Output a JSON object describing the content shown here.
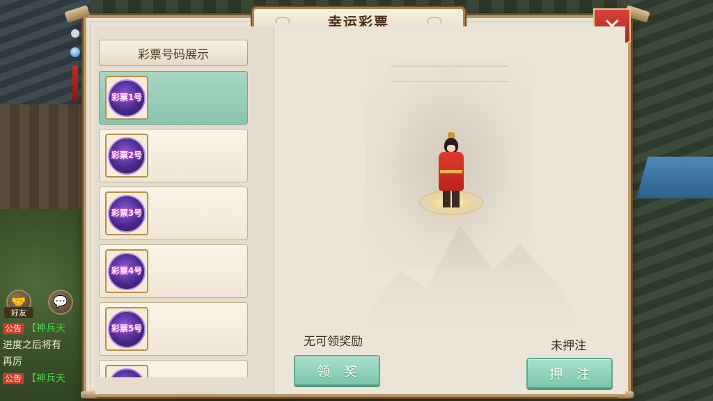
{
  "title": "幸运彩票",
  "close_label": "✕",
  "list_header": "彩票号码展示",
  "tickets": [
    {
      "label": "彩票1号",
      "selected": true
    },
    {
      "label": "彩票2号",
      "selected": false
    },
    {
      "label": "彩票3号",
      "selected": false
    },
    {
      "label": "彩票4号",
      "selected": false
    },
    {
      "label": "彩票5号",
      "selected": false
    },
    {
      "label": "",
      "selected": false
    }
  ],
  "reward_status": "无可领奖励",
  "claim_button": "领奖",
  "bet_status": "未押注",
  "bet_button": "押注",
  "chat": {
    "friends_label": "好友",
    "messages": [
      {
        "tag": "公告",
        "text": "【神兵天"
      },
      {
        "tag": "",
        "text": "进度之后将有"
      },
      {
        "tag": "",
        "text": "再厉"
      },
      {
        "tag": "公告",
        "text": "【神兵天"
      }
    ]
  }
}
